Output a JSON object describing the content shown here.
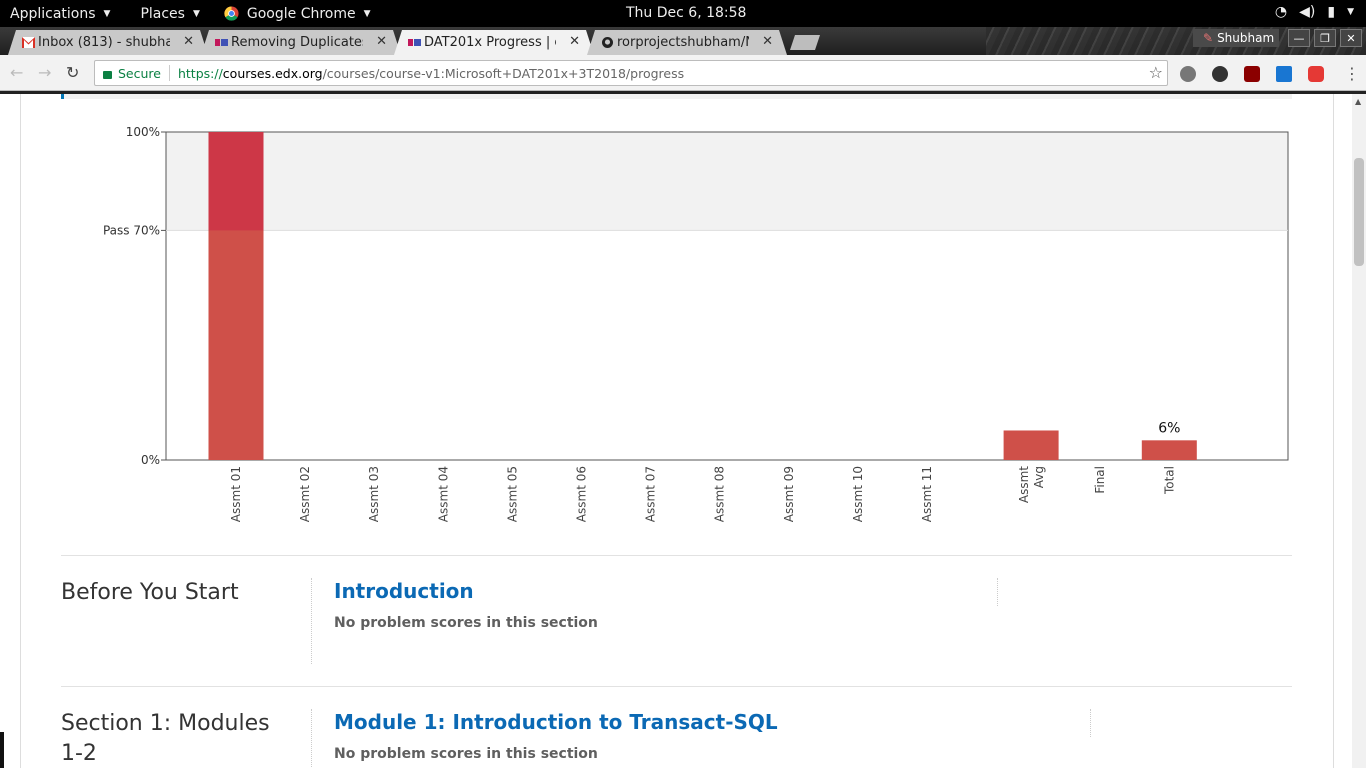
{
  "topbar": {
    "applications": "Applications",
    "places": "Places",
    "chrome": "Google Chrome",
    "clock": "Thu Dec  6, 18:58"
  },
  "tabs": [
    {
      "title": "Inbox (813) - shubha",
      "icon": "gmail-icon",
      "active": false
    },
    {
      "title": "Removing Duplicates",
      "icon": "edx-icon",
      "active": false
    },
    {
      "title": "DAT201x Progress | c",
      "icon": "edx-icon",
      "active": true
    },
    {
      "title": "rorprojectshubham/N",
      "icon": "github-icon",
      "active": false
    }
  ],
  "profile": "Shubham",
  "omnibox": {
    "secure": "Secure",
    "scheme": "https://",
    "host": "courses.edx.org",
    "path": "/courses/course-v1:Microsoft+DAT201x+3T2018/progress"
  },
  "chart_data": {
    "type": "bar",
    "categories": [
      "Assmt 01",
      "Assmt 02",
      "Assmt 03",
      "Assmt 04",
      "Assmt 05",
      "Assmt 06",
      "Assmt 07",
      "Assmt 08",
      "Assmt 09",
      "Assmt 10",
      "Assmt 11",
      "Assmt Avg",
      "Final",
      "Total"
    ],
    "values": [
      100,
      0,
      0,
      0,
      0,
      0,
      0,
      0,
      0,
      0,
      0,
      9,
      0,
      6
    ],
    "ylim": [
      0,
      100
    ],
    "yticks": [
      {
        "value": 100,
        "label": "100%"
      },
      {
        "value": 70,
        "label": "Pass 70%"
      },
      {
        "value": 0,
        "label": "0%"
      }
    ],
    "pass_value": 70,
    "total_label": "6%",
    "bar_color": "#cf5049",
    "pass_zone_color": "#f2f2f2"
  },
  "sections": [
    {
      "title": "Before You Start",
      "subsections": [
        {
          "title": "Introduction",
          "note": "No problem scores in this section"
        }
      ]
    },
    {
      "title": "Section 1: Modules 1-2",
      "subsections": [
        {
          "title": "Module 1: Introduction to Transact-SQL",
          "note": "No problem scores in this section"
        }
      ]
    }
  ]
}
